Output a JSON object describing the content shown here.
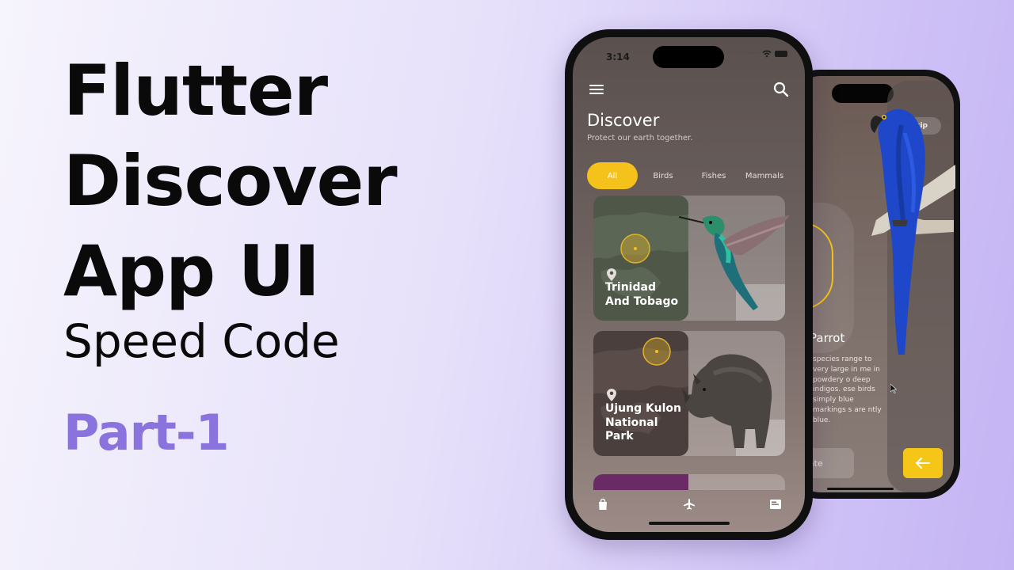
{
  "thumbnail": {
    "title_lines": [
      "Flutter",
      "Discover",
      "App UI"
    ],
    "subtitle": "Speed Code",
    "part": "Part-1",
    "part_color": "#8a73dc"
  },
  "back_phone": {
    "skip_label": "Skip",
    "species_name": "Parrot",
    "species_description": "species range to very large in me in powdery o deep indigos. ese birds simply blue markings s are ntly blue.",
    "donate_label": "onate",
    "arrow_icon": "arrow-left-icon",
    "accent": "#f5c517"
  },
  "front_phone": {
    "status_time": "3:14",
    "menu_icon": "menu-icon",
    "search_icon": "search-icon",
    "title": "Discover",
    "subtitle": "Protect our earth together.",
    "tabs": [
      {
        "label": "All",
        "active": true
      },
      {
        "label": "Birds",
        "active": false
      },
      {
        "label": "Fishes",
        "active": false
      },
      {
        "label": "Mammals",
        "active": false
      }
    ],
    "cards": [
      {
        "title_lines": [
          "Trinidad",
          "And Tobago"
        ],
        "animal": "hummingbird"
      },
      {
        "title_lines": [
          "Ujung Kulon",
          "National",
          "Park"
        ],
        "animal": "rhino"
      }
    ],
    "bottom_nav": [
      "shopping-bag-icon",
      "airplane-icon",
      "news-icon"
    ],
    "accent": "#f4c21b"
  }
}
